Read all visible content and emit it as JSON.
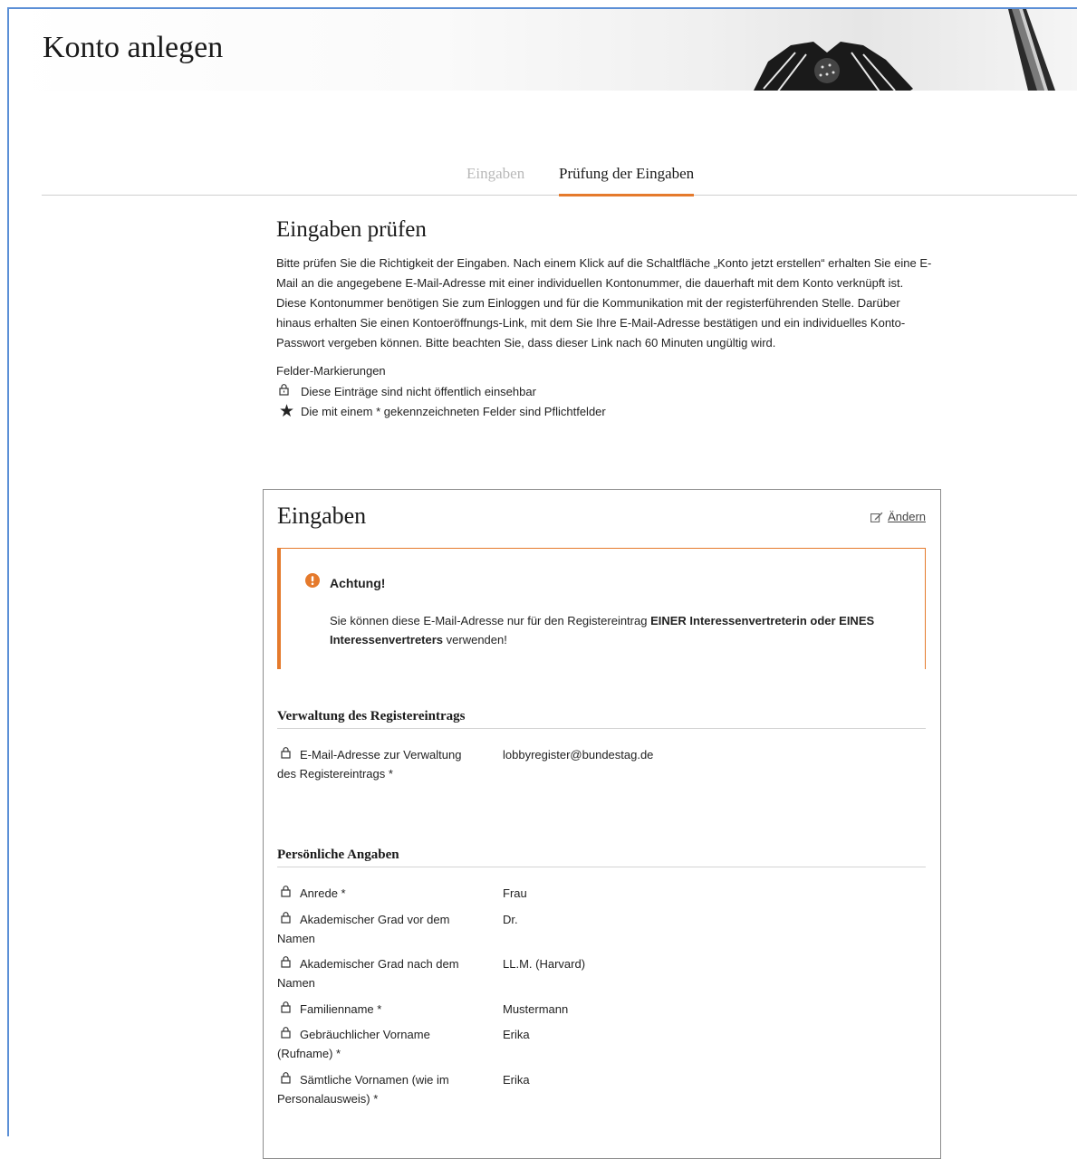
{
  "header": {
    "title": "Konto anlegen"
  },
  "tabs": [
    {
      "label": "Eingaben"
    },
    {
      "label": "Prüfung der Eingaben"
    }
  ],
  "review": {
    "title": "Eingaben prüfen",
    "intro": "Bitte prüfen Sie die Richtigkeit der Eingaben. Nach einem Klick auf die Schaltfläche „Konto jetzt erstellen“ erhalten Sie eine E-Mail an die angegebene E-Mail-Adresse mit einer individuellen Kontonummer, die dauerhaft mit dem Konto verknüpft ist. Diese Kontonummer benötigen Sie zum Einloggen und für die Kommunikation mit der registerführenden Stelle. Darüber hinaus erhalten Sie einen Kontoeröffnungs-Link, mit dem Sie Ihre E-Mail-Adresse bestätigen und ein individuelles Konto-Passwort vergeben können. Bitte beachten Sie, dass dieser Link nach 60 Minuten ungültig wird.",
    "markers_title": "Felder-Markierungen",
    "marker_private": "Diese Einträge sind nicht öffentlich einsehbar",
    "marker_required": "Die mit einem * gekennzeichneten Felder sind Pflichtfelder"
  },
  "card": {
    "title": "Eingaben",
    "edit_label": "Ändern",
    "alert": {
      "title": "Achtung!",
      "text_1": "Sie können diese E-Mail-Adresse nur für den Registereintrag ",
      "text_bold_1": "EINER Interessenvertreterin oder EINES Interessenvertreters",
      "text_2": " verwenden!"
    },
    "groups": [
      {
        "title": "Verwaltung des Registereintrags",
        "fields": [
          {
            "label": "E-Mail-Adresse zur Verwaltung des Registereintrags *",
            "value": "lobbyregister@bundestag.de"
          }
        ]
      },
      {
        "title": "Persönliche Angaben",
        "fields": [
          {
            "label": "Anrede *",
            "value": "Frau"
          },
          {
            "label": "Akademischer Grad vor dem Namen",
            "value": "Dr."
          },
          {
            "label": "Akademischer Grad nach dem Namen",
            "value": "LL.M. (Harvard)"
          },
          {
            "label": "Familienname *",
            "value": "Mustermann"
          },
          {
            "label": "Gebräuchlicher Vorname (Rufname) *",
            "value": "Erika"
          },
          {
            "label": "Sämtliche Vornamen (wie im Personalausweis) *",
            "value": "Erika"
          }
        ]
      }
    ]
  },
  "colors": {
    "accent": "#e57a2c",
    "frame": "#5b8fd6"
  },
  "icons": {
    "private": "lock-icon",
    "required": "asterisk-icon",
    "edit": "edit-icon",
    "alert": "exclamation-circle-icon"
  }
}
